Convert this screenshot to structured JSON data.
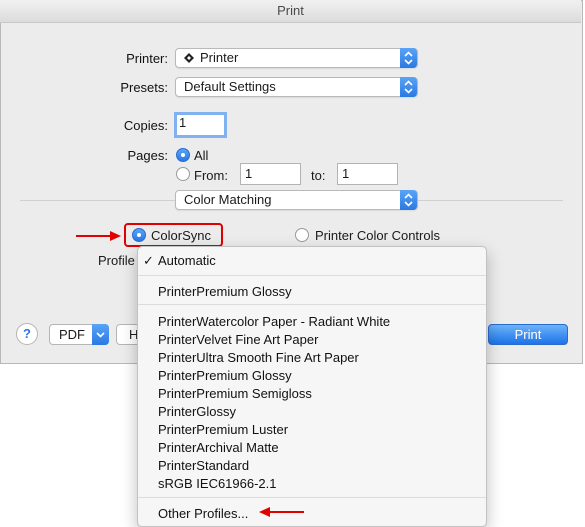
{
  "window": {
    "title": "Print"
  },
  "printer": {
    "label": "Printer:",
    "value": "Printer"
  },
  "presets": {
    "label": "Presets:",
    "value": "Default Settings"
  },
  "copies": {
    "label": "Copies:",
    "value": "1"
  },
  "pages": {
    "label": "Pages:",
    "all_label": "All",
    "from_label": "From:",
    "from_value": "1",
    "to_label": "to:",
    "to_value": "1"
  },
  "section": {
    "value": "Color Matching"
  },
  "colorsync": {
    "label": "ColorSync",
    "selected": true
  },
  "printer_color_controls": {
    "label": "Printer Color Controls",
    "selected": false
  },
  "profile": {
    "label": "Profile"
  },
  "bottom_bar": {
    "help_label": "?",
    "pdf_label": "PDF",
    "hidden_button_partial": "H",
    "print_label": "Print"
  },
  "menu": {
    "items": [
      "Automatic",
      "PrinterPremium Glossy",
      "PrinterWatercolor Paper - Radiant White",
      "PrinterVelvet Fine Art Paper",
      "PrinterUltra Smooth Fine Art Paper",
      "PrinterPremium Glossy",
      "PrinterPremium Semigloss",
      "PrinterGlossy",
      "PrinterPremium Luster",
      "PrinterArchival Matte",
      "PrinterStandard",
      "sRGB IEC61966-2.1",
      "Other Profiles..."
    ],
    "checked_item": "Automatic"
  },
  "colors": {
    "accent": "#2a78e4",
    "annotation": "#e00000"
  }
}
